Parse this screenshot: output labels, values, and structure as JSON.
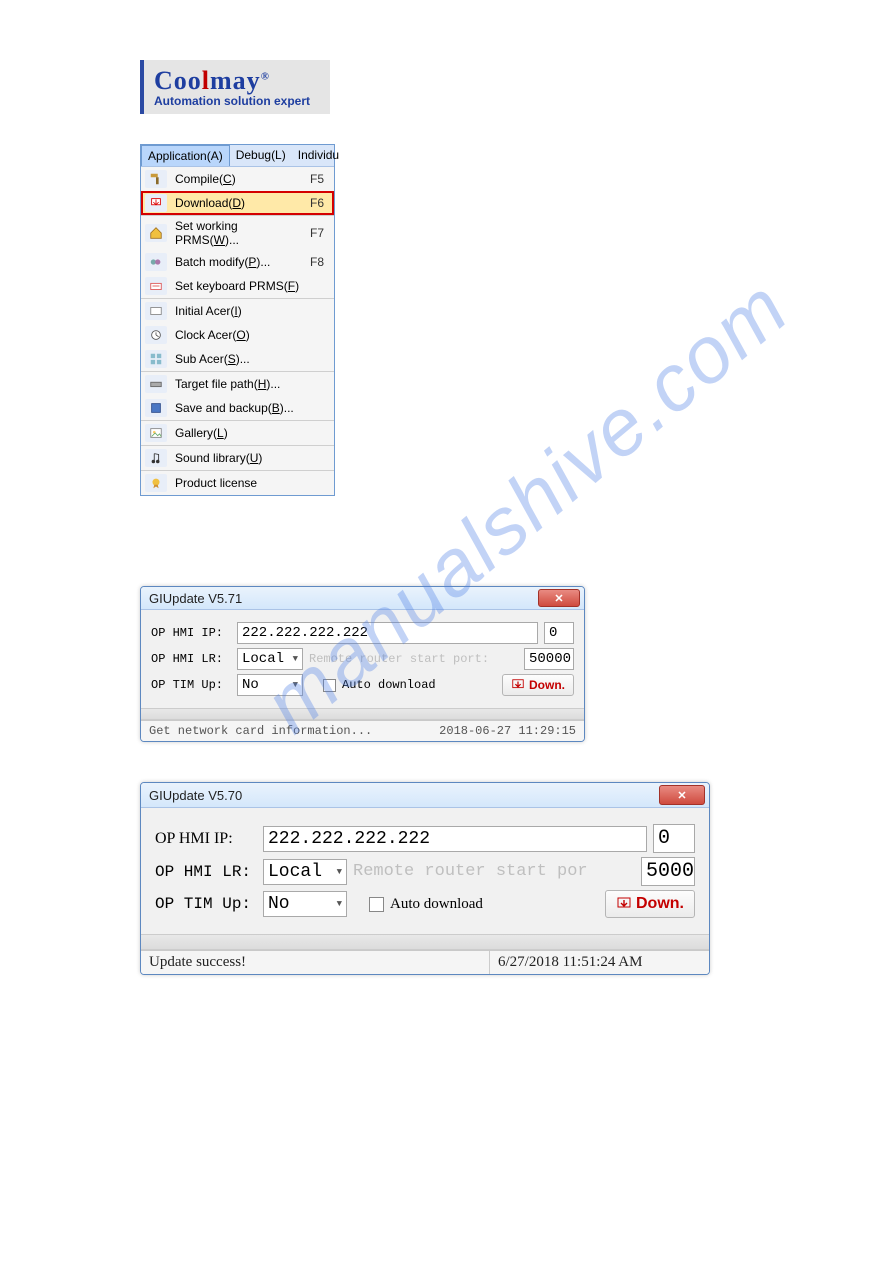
{
  "logo": {
    "text_pre": "Coo",
    "text_mid": "l",
    "text_post": "may",
    "reg": "®",
    "subtitle": "Automation solution expert"
  },
  "menubar": {
    "tabs": [
      "Application(A)",
      "Debug(L)",
      "Individu"
    ]
  },
  "menu": {
    "groups": [
      [
        {
          "label": "Compile(C)",
          "shortcut": "F5",
          "icon": "hammer"
        },
        {
          "label": "Download(D)",
          "shortcut": "F6",
          "highlight": true,
          "icon": "download"
        }
      ],
      [
        {
          "label": "Set working PRMS(W)...",
          "shortcut": "F7",
          "icon": "home"
        },
        {
          "label": "Batch modify(P)...",
          "shortcut": "F8",
          "icon": "batch"
        },
        {
          "label": "Set keyboard PRMS(F)",
          "icon": "keyboard"
        }
      ],
      [
        {
          "label": "Initial Acer(I)",
          "icon": "card"
        },
        {
          "label": "Clock Acer(O)",
          "icon": "clock"
        },
        {
          "label": "Sub Acer(S)...",
          "icon": "grid"
        }
      ],
      [
        {
          "label": "Target file path(H)...",
          "icon": "drive"
        },
        {
          "label": "Save and backup(B)...",
          "icon": "disk"
        }
      ],
      [
        {
          "label": "Gallery(L)",
          "icon": "image"
        }
      ],
      [
        {
          "label": "Sound library(U)",
          "icon": "music"
        }
      ],
      [
        {
          "label": "Product license",
          "icon": "license"
        }
      ]
    ]
  },
  "dialog1": {
    "title": "GIUpdate V5.71",
    "ip_label": "OP HMI IP:",
    "ip_value": "222.222.222.222",
    "ip_num": "0",
    "lr_label": "OP HMI LR:",
    "lr_value": "Local",
    "remote_text": "Remote router start port:",
    "remote_port": "50000",
    "tim_label": "OP TIM Up:",
    "tim_value": "No",
    "auto_label": "Auto download",
    "down_label": "Down.",
    "status_left": "Get network card information...",
    "status_right": "2018-06-27  11:29:15"
  },
  "dialog2": {
    "title": "GIUpdate V5.70",
    "ip_label": "OP HMI IP:",
    "ip_value": "222.222.222.222",
    "ip_num": "0",
    "lr_label": "OP HMI LR:",
    "lr_value": "Local",
    "remote_text": "Remote router start por",
    "remote_port": "5000",
    "tim_label": "OP TIM Up:",
    "tim_value": "No",
    "auto_label": "Auto download",
    "down_label": "Down.",
    "status_left": "Update success!",
    "status_right": "6/27/2018  11:51:24 AM"
  },
  "watermark": "manualshive.com"
}
